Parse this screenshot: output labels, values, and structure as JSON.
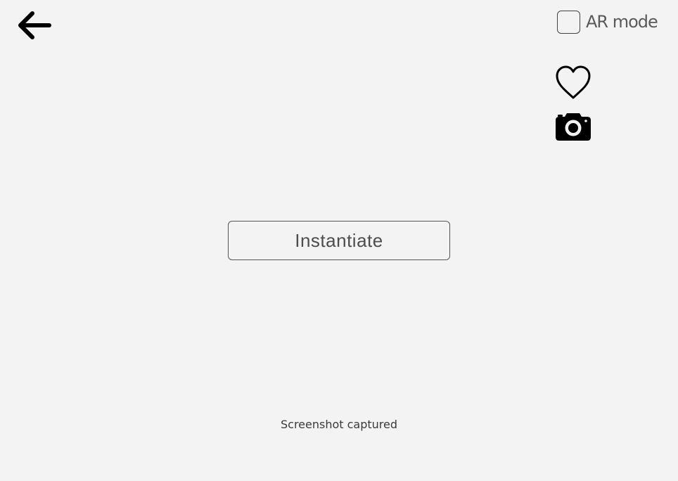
{
  "toolbar": {
    "back_icon": "arrow-left-icon",
    "ar_mode": {
      "label": "AR mode",
      "checked": false
    },
    "favorite_icon": "heart-outline-icon",
    "camera_icon": "camera-icon"
  },
  "main": {
    "instantiate_label": "Instantiate"
  },
  "status": {
    "message": "Screenshot captured"
  },
  "colors": {
    "background": "#f3f3f3",
    "icon": "#000000",
    "text": "#4d4d4d"
  }
}
